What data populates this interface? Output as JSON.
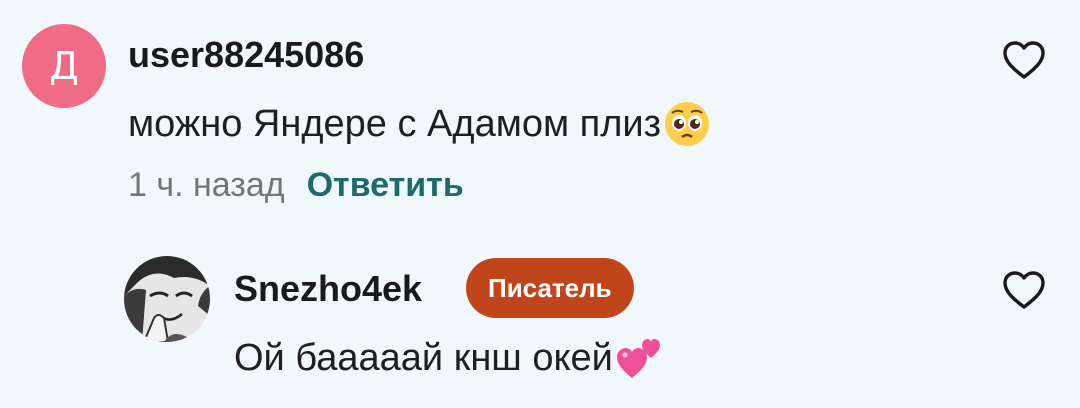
{
  "comments": [
    {
      "avatar_letter": "Д",
      "username": "user88245086",
      "text": "можно Яндере с Адамом плиз",
      "emoji": "pleading-face",
      "time": "1 ч. назад",
      "reply_label": "Ответить"
    }
  ],
  "replies": [
    {
      "username": "Snezho4ek",
      "badge": "Писатель",
      "text": "Ой бааааай кнш окей",
      "emoji": "two-hearts"
    }
  ],
  "colors": {
    "background": "#f0f8fb",
    "avatar": "#f06b86",
    "reply_link": "#1c6b6b",
    "badge": "#c0451b",
    "time": "#757575"
  }
}
